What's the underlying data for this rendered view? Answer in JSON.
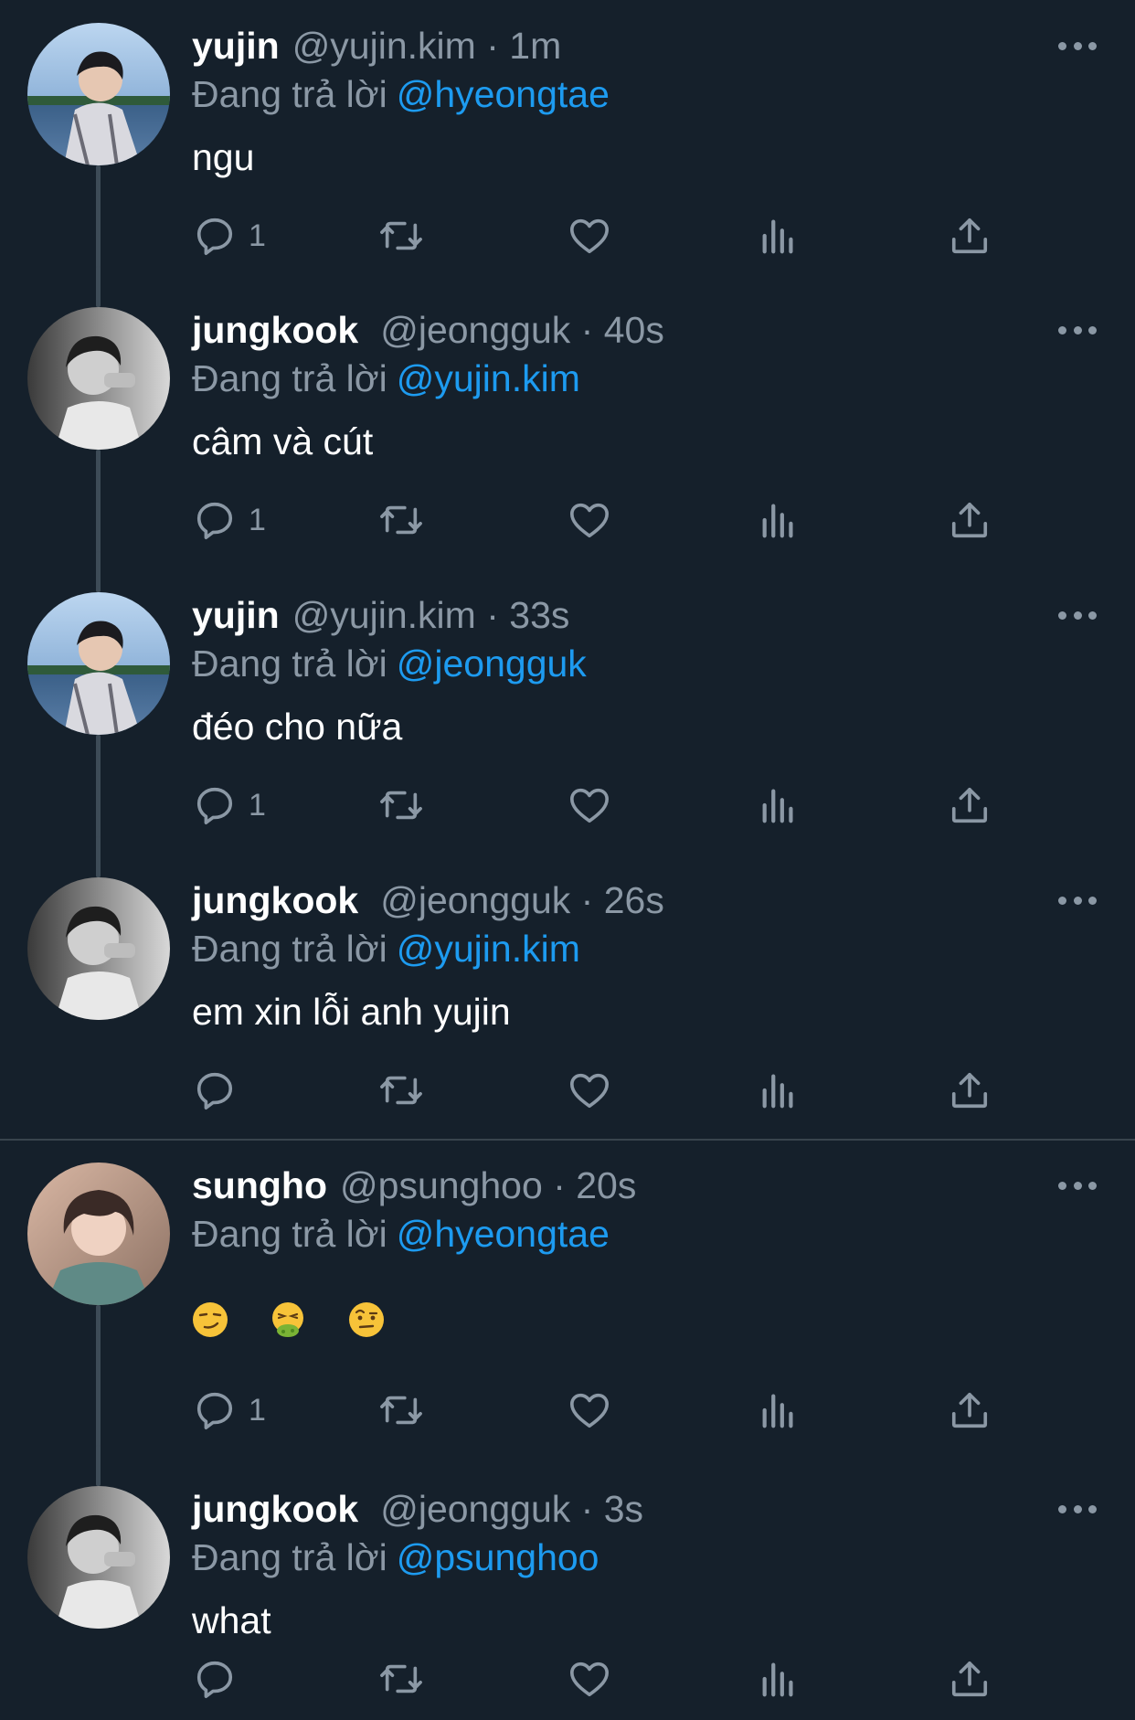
{
  "labels": {
    "replying_to": "Đang trả lời",
    "dot": "·"
  },
  "icons": [
    "more-icon",
    "reply-icon",
    "retweet-icon",
    "like-icon",
    "views-icon",
    "share-icon"
  ],
  "colors": {
    "background": "#15202b",
    "secondary_text": "#8b98a5",
    "mention": "#1d9bf0",
    "thread_line": "#3d4b57"
  },
  "tweets": [
    {
      "name": "yujin",
      "handle": "@yujin.kim",
      "time": "1m",
      "replying_to": "@hyeongtae",
      "text": "ngu",
      "reply_count": "1"
    },
    {
      "name": "jungkook",
      "handle": "@jeongguk",
      "time": "40s",
      "replying_to": "@yujin.kim",
      "text": "câm và cút",
      "reply_count": "1"
    },
    {
      "name": "yujin",
      "handle": "@yujin.kim",
      "time": "33s",
      "replying_to": "@jeongguk",
      "text": "đéo cho nữa",
      "reply_count": "1"
    },
    {
      "name": "jungkook",
      "handle": "@jeongguk",
      "time": "26s",
      "replying_to": "@yujin.kim",
      "text": "em xin lỗi anh yujin",
      "reply_count": ""
    },
    {
      "name": "sungho",
      "handle": "@psunghoo",
      "time": "20s",
      "replying_to": "@hyeongtae",
      "text": "",
      "emojis": [
        "smirking-face-emoji",
        "nauseated-face-emoji",
        "face-with-raised-eyebrow-emoji"
      ],
      "reply_count": "1"
    },
    {
      "name": "jungkook",
      "handle": "@jeongguk",
      "time": "3s",
      "replying_to": "@psunghoo",
      "text": "what",
      "reply_count": ""
    }
  ]
}
